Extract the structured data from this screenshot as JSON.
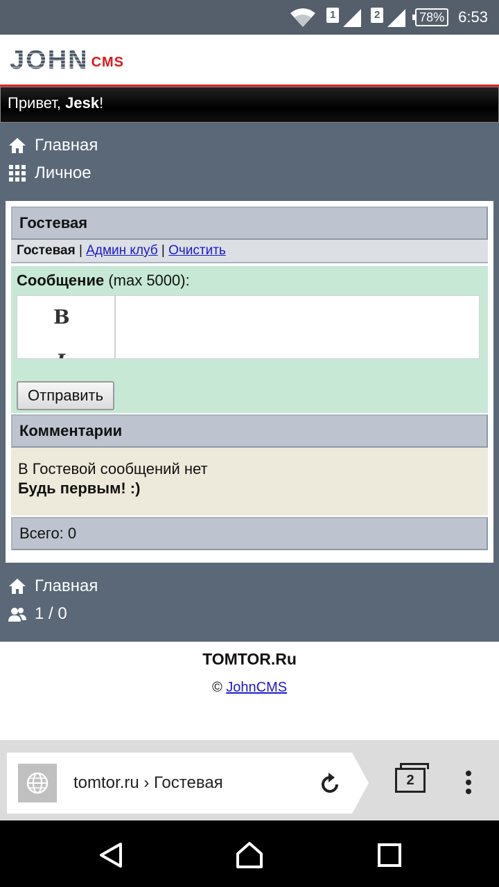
{
  "status_bar": {
    "sim1": "1",
    "sim2": "2",
    "battery": "78%",
    "time": "6:53"
  },
  "header": {
    "logo_main": "JOHN",
    "logo_sub": "CMS",
    "greeting_prefix": "Привет, ",
    "username": "Jesk",
    "greeting_suffix": "!"
  },
  "top_nav": {
    "home": "Главная",
    "personal": "Личное"
  },
  "guestbook": {
    "title": "Гостевая",
    "tabs": {
      "current": "Гостевая",
      "sep": " | ",
      "admin_club": "Админ клуб",
      "clear": "Очистить"
    },
    "form": {
      "label": "Сообщение",
      "limit": " (max 5000):",
      "bold_btn": "B",
      "italic_btn": "I",
      "submit": "Отправить"
    },
    "comments_title": "Комментарии",
    "empty_text": "В Гостевой сообщений нет",
    "empty_call": "Будь первым! :)",
    "total": "Всего: 0"
  },
  "bottom_nav": {
    "home": "Главная",
    "online": "1 / 0"
  },
  "footer": {
    "brand": "TOMTOR.Ru",
    "copyright_symbol": "©",
    "copyright_link": "JohnCMS"
  },
  "browser": {
    "url": "tomtor.ru › Гостевая",
    "tab_count": "2"
  },
  "icons": {
    "wifi": "wifi-icon",
    "signal": "signal-icon",
    "home": "home-icon",
    "grid": "grid-icon",
    "users": "users-icon",
    "globe": "globe-icon",
    "reload": "reload-icon",
    "menu": "kebab-menu-icon"
  }
}
